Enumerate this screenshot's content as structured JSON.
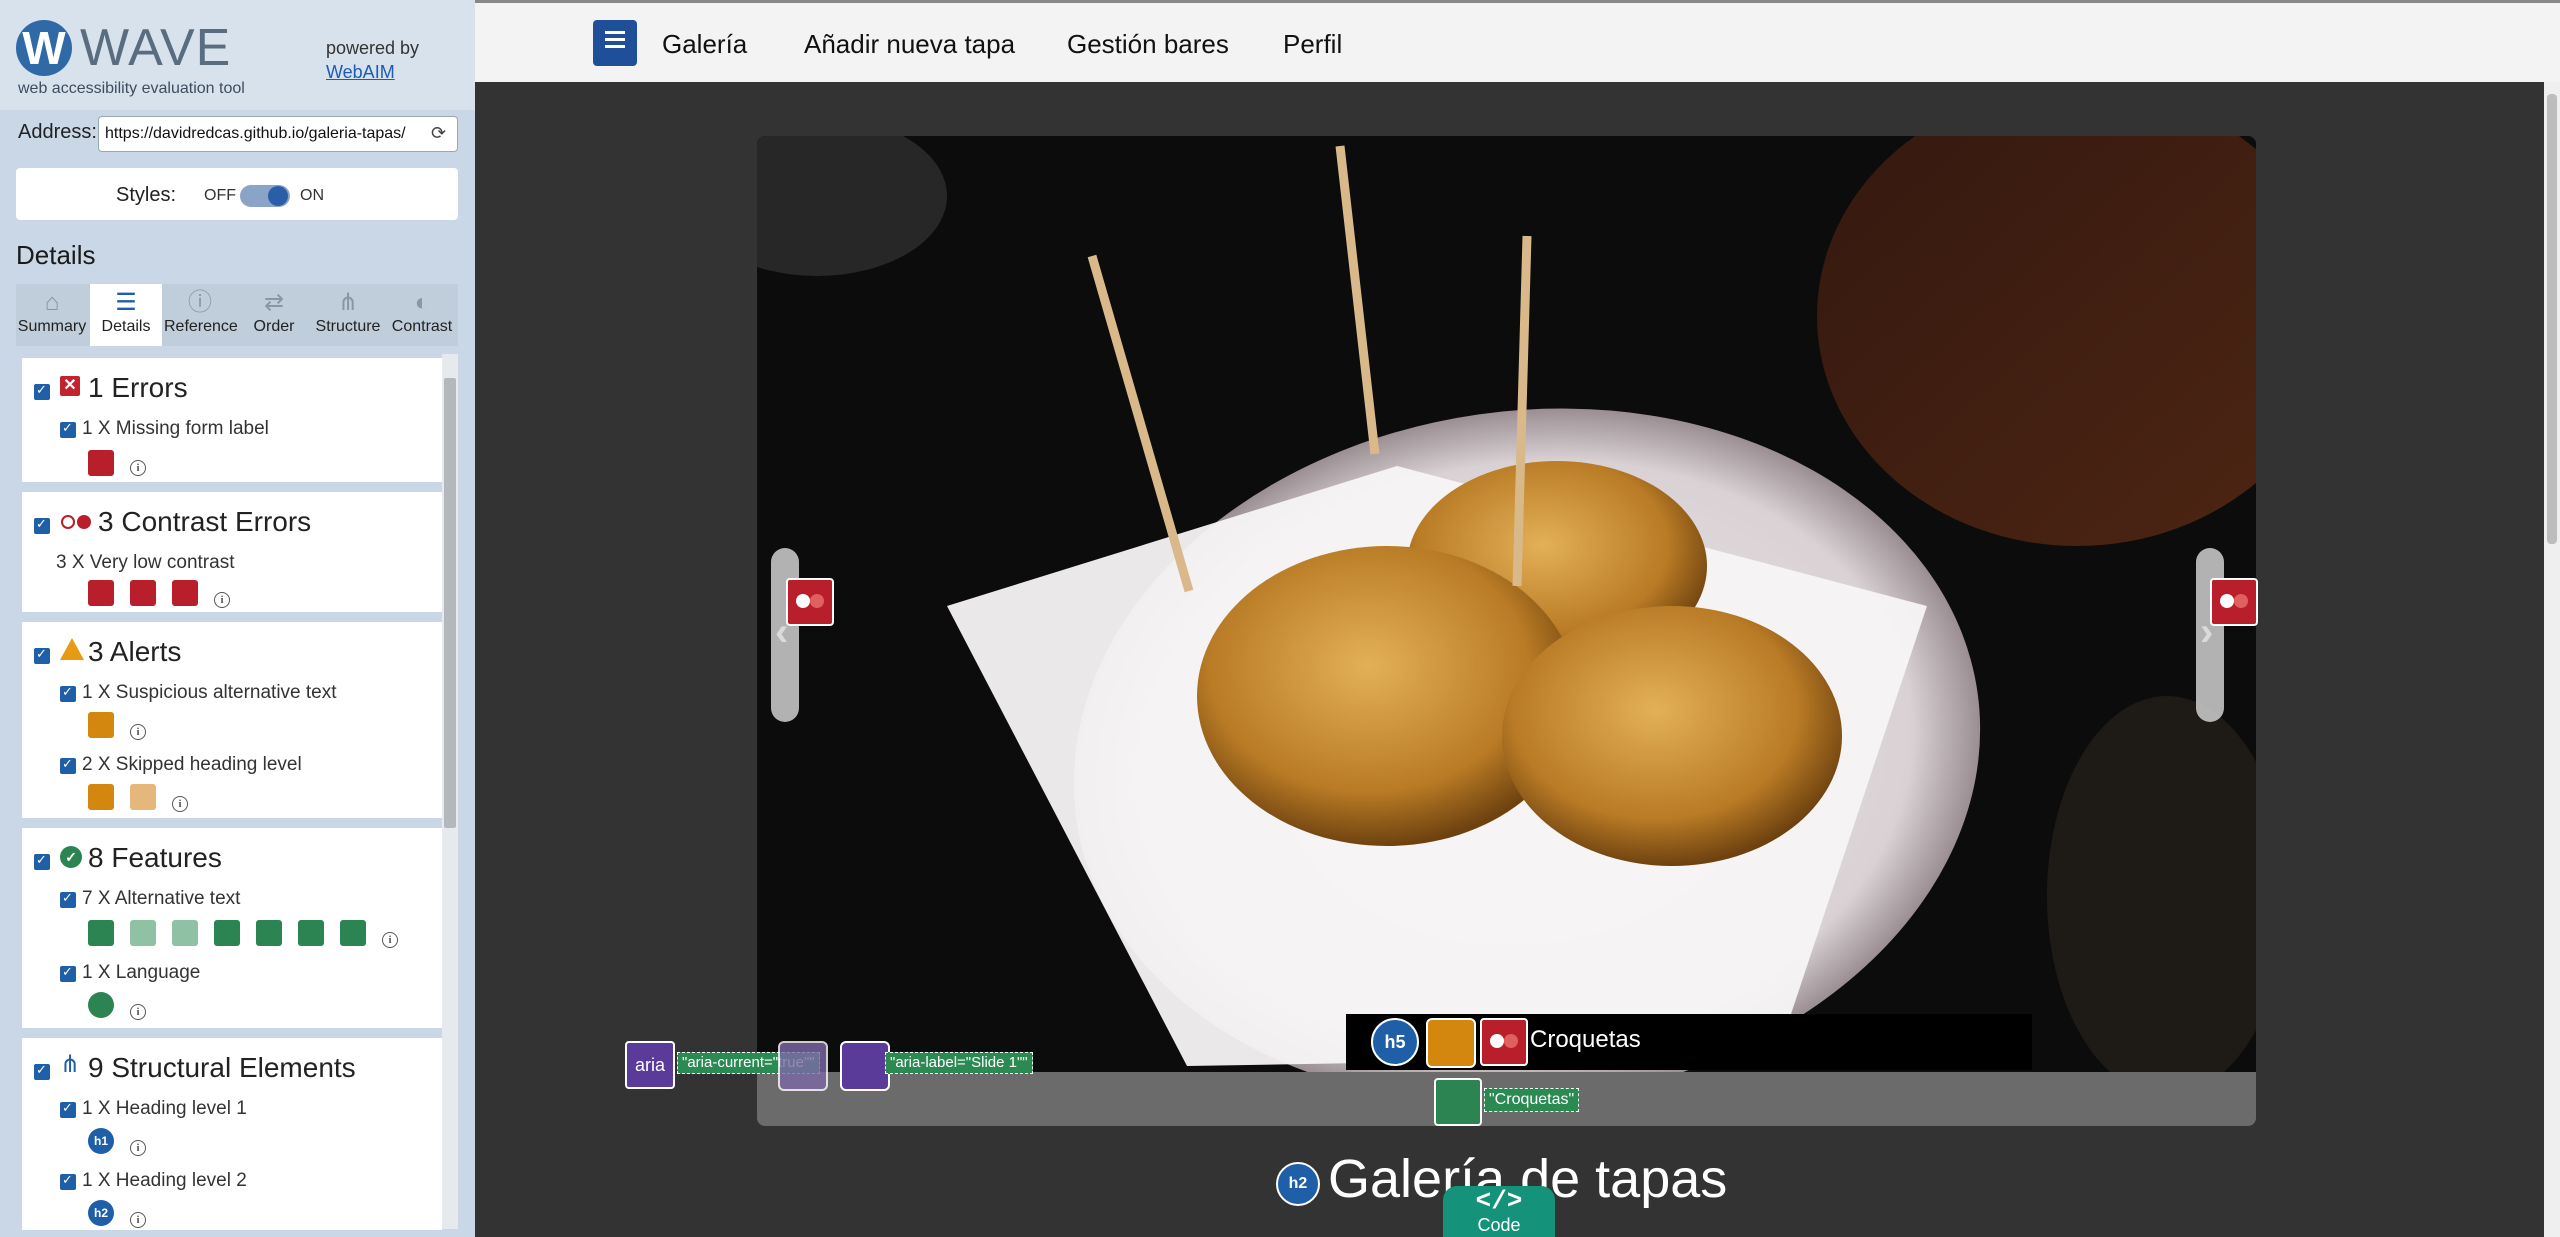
{
  "wave": {
    "logo_letter": "W",
    "name": "WAVE",
    "tagline": "web accessibility evaluation tool",
    "powered_by": "powered by",
    "webaim_link": "WebAIM",
    "address_label": "Address:",
    "address_value": "https://davidredcas.github.io/galeria-tapas/",
    "styles_label": "Styles:",
    "styles_off": "OFF",
    "styles_on": "ON",
    "details_heading": "Details"
  },
  "tabs": [
    {
      "label": "Summary",
      "icon": "home-icon"
    },
    {
      "label": "Details",
      "icon": "list-icon"
    },
    {
      "label": "Reference",
      "icon": "info-icon"
    },
    {
      "label": "Order",
      "icon": "order-icon"
    },
    {
      "label": "Structure",
      "icon": "structure-icon"
    },
    {
      "label": "Contrast",
      "icon": "contrast-icon"
    }
  ],
  "details": {
    "errors": {
      "heading": "1 Errors",
      "items": [
        "1 X Missing form label"
      ]
    },
    "contrast": {
      "heading": "3 Contrast Errors",
      "items": [
        "3 X Very low contrast"
      ]
    },
    "alerts": {
      "heading": "3 Alerts",
      "items": [
        "1 X Suspicious alternative text",
        "2 X Skipped heading level"
      ]
    },
    "features": {
      "heading": "8 Features",
      "items": [
        "7 X Alternative text",
        "1 X Language"
      ]
    },
    "structure": {
      "heading": "9 Structural Elements",
      "items": [
        "1 X Heading level 1",
        "1 X Heading level 2"
      ]
    }
  },
  "badges": {
    "h1": "h1",
    "h2": "h2",
    "h5": "h5",
    "aria": "aria",
    "code_symbol": "</>",
    "code_label": "Code"
  },
  "nav": {
    "links": [
      "Galería",
      "Añadir nueva tapa",
      "Gestión bares",
      "Perfil"
    ]
  },
  "carousel": {
    "caption": "Croquetas",
    "alt_text": "\"Croquetas\"",
    "aria_current": "\"aria-current=\"true\"\"",
    "aria_label": "\"aria-label=\"Slide 1\"\"",
    "prev_symbol": "‹",
    "next_symbol": "›"
  },
  "page": {
    "title": "Galería de tapas"
  },
  "colors": {
    "error": "#b81f2b",
    "alert": "#d4870e",
    "feature": "#2b8452",
    "structure": "#1f5fa8",
    "aria": "#5b3b9a",
    "code": "#14937a"
  }
}
